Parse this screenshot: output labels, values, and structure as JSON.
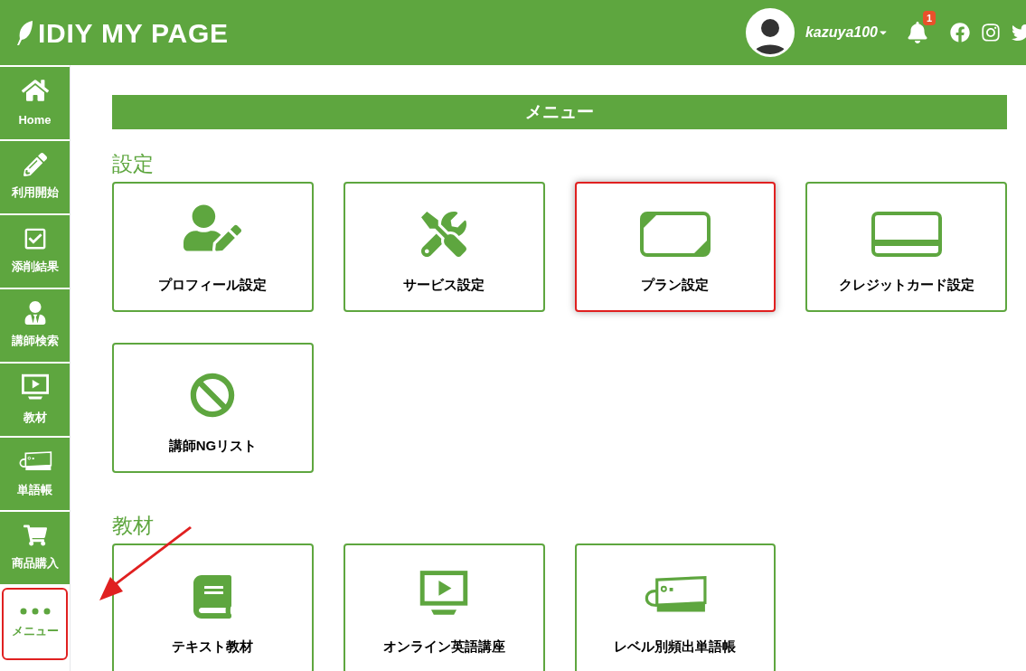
{
  "header": {
    "logo": "IDIY MY PAGE",
    "username": "kazuya100",
    "notification_count": "1"
  },
  "sidebar": {
    "items": [
      {
        "kind": "home",
        "label": "Home",
        "selected": false,
        "highlighted": false
      },
      {
        "kind": "pencil",
        "label": "利用開始",
        "selected": false,
        "highlighted": false
      },
      {
        "kind": "check",
        "label": "添削結果",
        "selected": false,
        "highlighted": false
      },
      {
        "kind": "teacher",
        "label": "講師検索",
        "selected": false,
        "highlighted": false
      },
      {
        "kind": "monitor",
        "label": "教材",
        "selected": false,
        "highlighted": false
      },
      {
        "kind": "tag",
        "label": "単語帳",
        "selected": false,
        "highlighted": false
      },
      {
        "kind": "cart",
        "label": "商品購入",
        "selected": false,
        "highlighted": false
      },
      {
        "kind": "dots",
        "label": "メニュー",
        "selected": true,
        "highlighted": true
      }
    ]
  },
  "main": {
    "title": "メニュー",
    "sections": [
      {
        "heading": "設定",
        "cards": [
          {
            "kind": "user-edit",
            "label": "プロフィール設定",
            "highlighted": false
          },
          {
            "kind": "tools",
            "label": "サービス設定",
            "highlighted": false
          },
          {
            "kind": "plan",
            "label": "プラン設定",
            "highlighted": true
          },
          {
            "kind": "credit-card",
            "label": "クレジットカード設定",
            "highlighted": false
          },
          {
            "kind": "ban",
            "label": "講師NGリスト",
            "highlighted": false
          }
        ]
      },
      {
        "heading": "教材",
        "cards": [
          {
            "kind": "book",
            "label": "テキスト教材",
            "highlighted": false
          },
          {
            "kind": "monitor",
            "label": "オンライン英語講座",
            "highlighted": false
          },
          {
            "kind": "tag",
            "label": "レベル別頻出単語帳",
            "highlighted": false
          }
        ]
      }
    ]
  }
}
